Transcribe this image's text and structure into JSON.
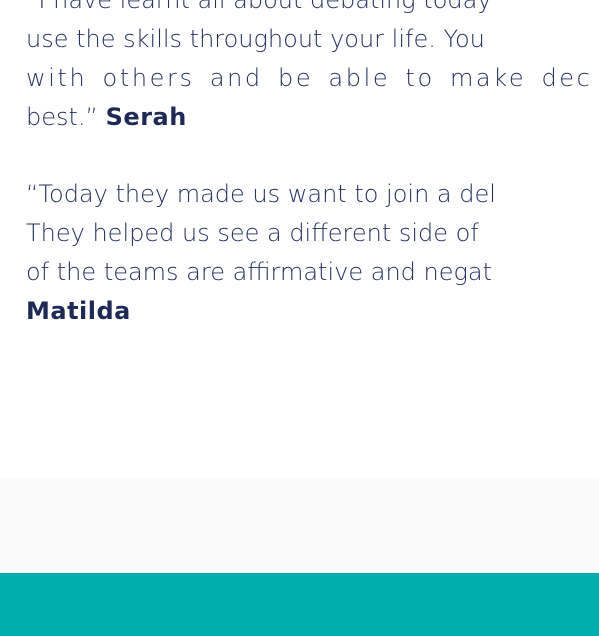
{
  "testimonials": [
    {
      "lines": [
        "“I have learnt all about debating today",
        "use the skills throughout your life. You",
        "with others and be able to make dec",
        "best.”"
      ],
      "author": "Serah"
    },
    {
      "lines": [
        "“Today they made us want to join a del",
        "They helped us see a different side of",
        "of the teams are affirmative and negat"
      ],
      "author": "Matilda"
    }
  ],
  "colors": {
    "text": "#23325e",
    "author": "#1d2a55",
    "footer": "#00aeb0",
    "background": "#ffffff"
  }
}
